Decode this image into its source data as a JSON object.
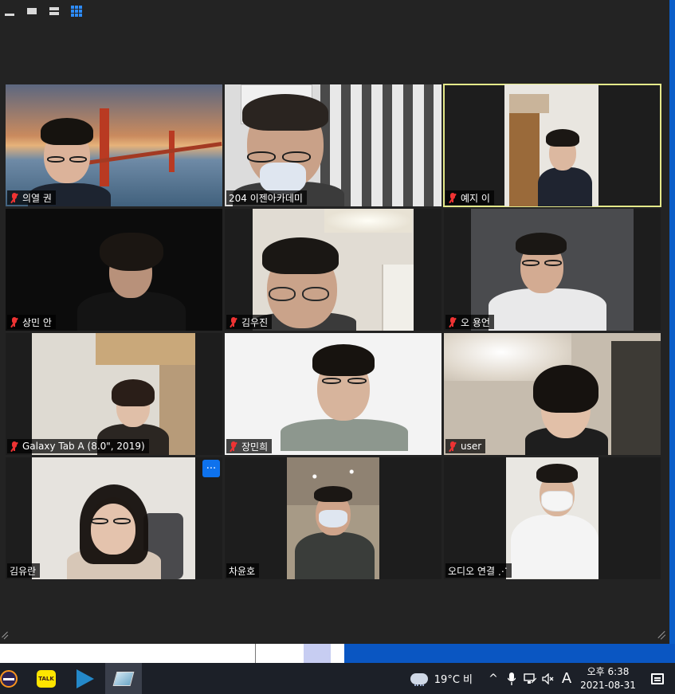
{
  "colors": {
    "window_bg": "#232323",
    "active_border": "#e5e98a",
    "accent_blue": "#2d8cff",
    "muted_red": "#e33333",
    "taskbar_bg": "#1c2028"
  },
  "view_controls": [
    "minimize-icon",
    "speaker-view-icon",
    "stacked-view-icon",
    "gallery-view-icon"
  ],
  "participants": [
    {
      "name": "의열 권",
      "muted": true
    },
    {
      "name": "204 이젠아카데미",
      "muted": false
    },
    {
      "name": "예지 이",
      "muted": true,
      "active_speaker": true
    },
    {
      "name": "상민 안",
      "muted": true
    },
    {
      "name": "김우진",
      "muted": true
    },
    {
      "name": "오 용언",
      "muted": true
    },
    {
      "name": "Galaxy Tab A (8.0\", 2019)",
      "muted": true
    },
    {
      "name": "장민희",
      "muted": true
    },
    {
      "name": "user",
      "muted": true
    },
    {
      "name": "김유란",
      "muted": false
    },
    {
      "name": "차윤호",
      "muted": false
    },
    {
      "name": "오디오 연결 ⋰",
      "muted": false
    }
  ],
  "more_button": "···",
  "taskbar": {
    "apps": [
      "eclipse-icon",
      "kakaotalk-icon",
      "vscode-icon",
      "zoom-icon"
    ],
    "kakao_label": "TALK",
    "weather": "19°C  비",
    "ime": "A",
    "time": "오후 6:38",
    "date": "2021-08-31"
  }
}
